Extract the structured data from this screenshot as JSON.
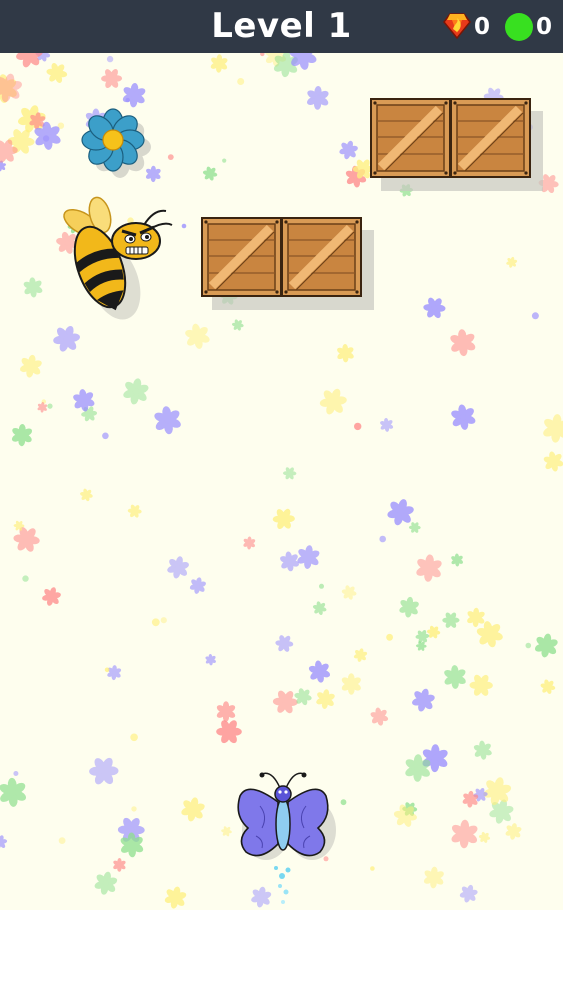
{
  "hud": {
    "level_label": "Level 1",
    "gems": "0",
    "coins": "0",
    "gem_icon": "fire-gem-icon",
    "coin_icon": "green-coin-icon",
    "colors": {
      "bar": "#303946",
      "coin": "#38e020",
      "gem": "#e83a1a"
    }
  },
  "playfield": {
    "background": "#fefeee",
    "sprites": [
      "bee-enemy",
      "blue-flower-pickup",
      "wooden-crate",
      "butterfly-player"
    ],
    "colors": {
      "crate": "#d99b55",
      "bee": "#f2b81a",
      "butterfly": "#7f78ea",
      "flower": "#3c9fc9"
    }
  }
}
